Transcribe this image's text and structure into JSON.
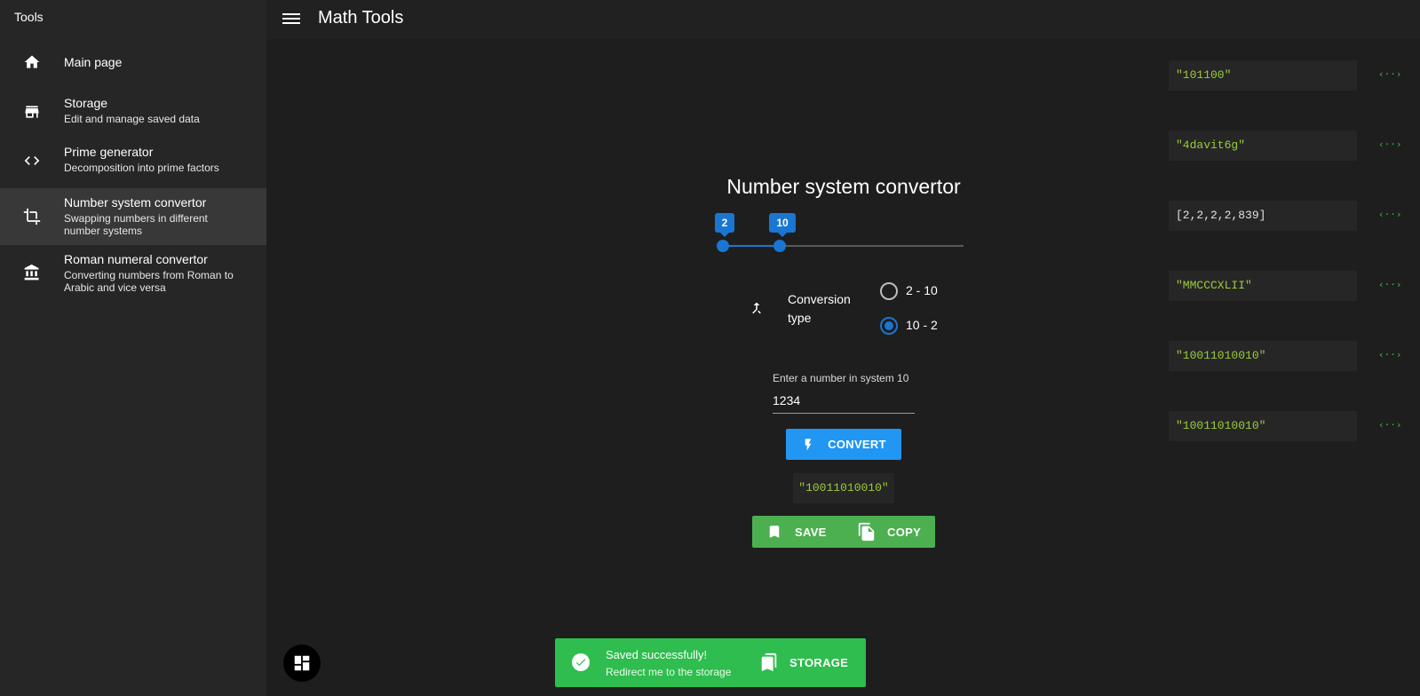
{
  "sidebar": {
    "title": "Tools",
    "items": [
      {
        "label": "Main page",
        "sub": "",
        "icon": "home-icon"
      },
      {
        "label": "Storage",
        "sub": "Edit and manage saved data",
        "icon": "store-icon"
      },
      {
        "label": "Prime generator",
        "sub": "Decomposition into prime factors",
        "icon": "code-icon"
      },
      {
        "label": "Number system convertor",
        "sub_line1": "Swapping numbers in different",
        "sub_line2": "number systems",
        "icon": "crop-icon",
        "active": true
      },
      {
        "label": "Roman numeral convertor",
        "sub_line1": "Converting numbers from Roman to",
        "sub_line2": "Arabic and vice versa",
        "icon": "bank-icon"
      }
    ]
  },
  "header": {
    "title": "Math Tools",
    "menu_icon": "menu-icon"
  },
  "history": [
    "\"101100\"",
    "\"4davit6g\"",
    "[2,2,2,2,839]",
    "\"MMCCCXLII\"",
    "\"10011010010\"",
    "\"10011010010\""
  ],
  "history_link_icon": "‹··›",
  "converter": {
    "title": "Number system convertor",
    "slider": {
      "from": 2,
      "to": 10,
      "from_label": "2",
      "to_label": "10"
    },
    "conversion_label_line1": "Conversion",
    "conversion_label_line2": "type",
    "options": [
      "2 - 10",
      "10 - 2"
    ],
    "selected_option": "10 - 2",
    "input_label": "Enter a number in system 10",
    "input_value": "1234",
    "convert_label": "CONVERT",
    "result": "\"10011010010\"",
    "save_label": "SAVE",
    "copy_label": "COPY"
  },
  "snackbar": {
    "title": "Saved successfully!",
    "subtitle": "Redirect me to the storage",
    "action": "STORAGE"
  },
  "colors": {
    "accent": "#1976d2",
    "button_blue": "#2196f3",
    "success": "#4caf50",
    "snackbar": "#2ebd4e",
    "code_green": "#9ccc3b"
  }
}
